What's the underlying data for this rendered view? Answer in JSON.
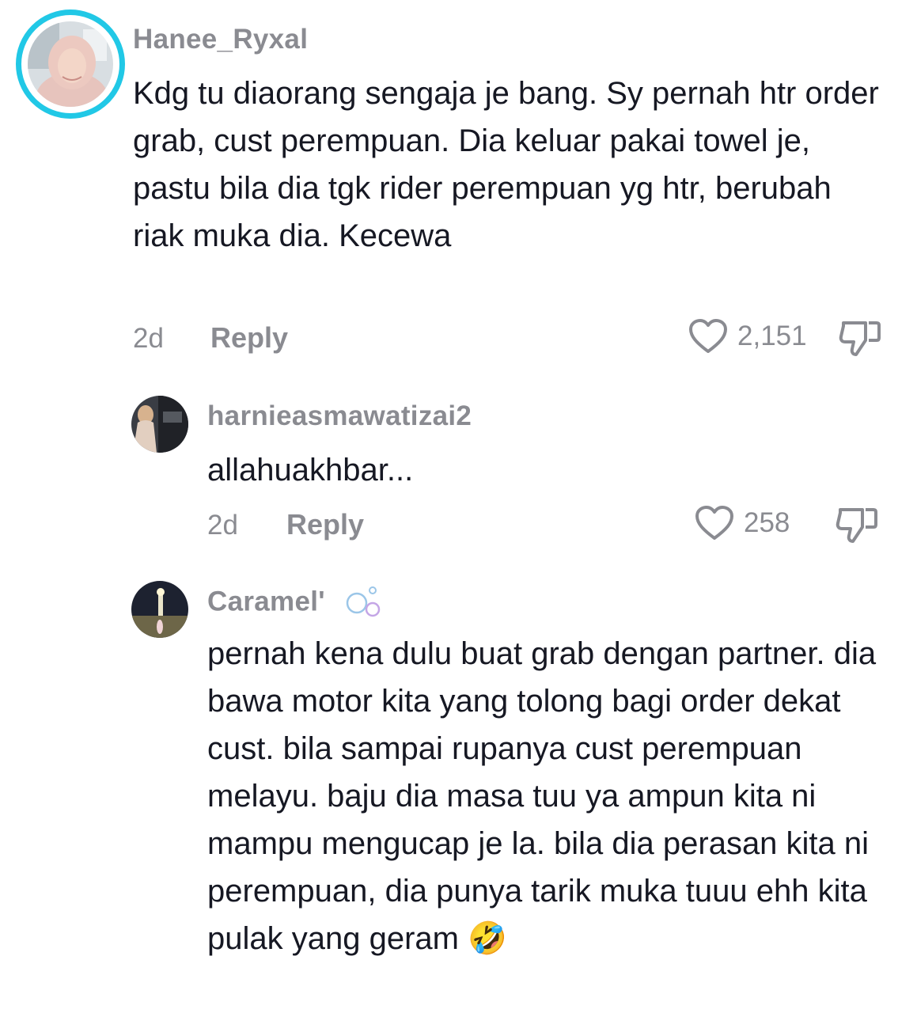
{
  "comments": [
    {
      "username": "Hanee_Ryxal",
      "text": "Kdg tu diaorang sengaja je bang. Sy pernah htr order grab, cust perempuan. Dia keluar pakai towel je, pastu bila dia tgk rider perempuan yg htr, berubah riak muka dia. Kecewa",
      "time": "2d",
      "reply_label": "Reply",
      "likes": "2,151"
    },
    {
      "username": "harnieasmawatizai2",
      "text": "allahuakhbar...",
      "time": "2d",
      "reply_label": "Reply",
      "likes": "258"
    },
    {
      "username": "Caramel'",
      "text": "pernah kena dulu buat grab dengan partner. dia bawa motor kita yang tolong bagi order dekat cust. bila sampai rupanya cust perempuan melayu. baju dia masa tuu ya ampun kita ni mampu mengucap je la. bila dia perasan kita ni perempuan, dia punya tarik muka tuuu ehh kita pulak yang geram 🤣"
    }
  ],
  "icons": {
    "like": "heart-outline-icon",
    "dislike": "thumbs-down-icon",
    "username_decoration": "bubbles-icon"
  },
  "colors": {
    "ring": "#21c8e6",
    "muted": "#8a8b91",
    "text": "#161823"
  }
}
